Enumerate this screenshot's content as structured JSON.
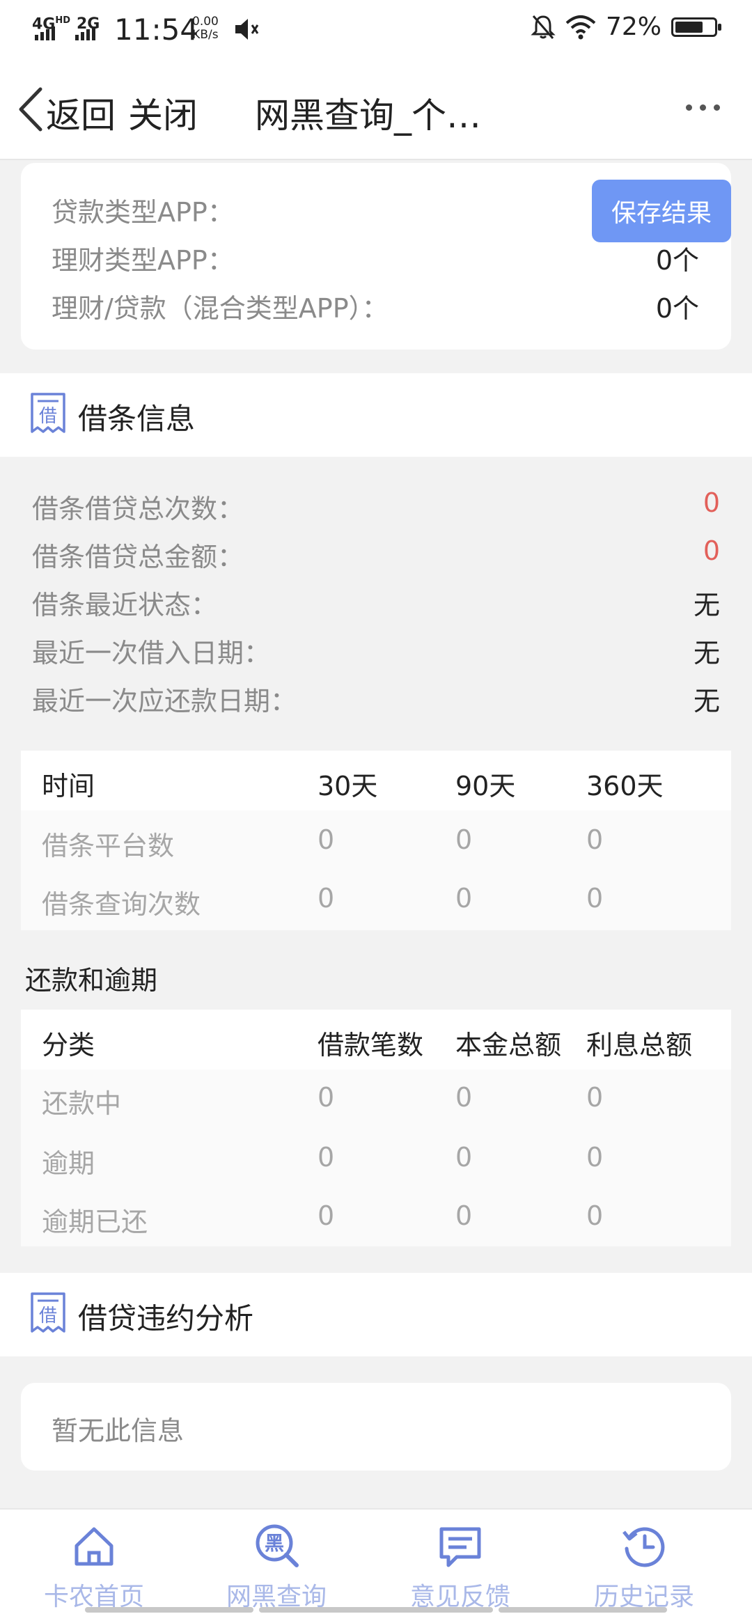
{
  "status_bar": {
    "network1": "4G",
    "network1_sup": "HD",
    "network2": "2G",
    "time": "11:54",
    "speed_value": "0.00",
    "speed_unit": "KB/s",
    "battery": "72%",
    "battery_level": 0.72
  },
  "nav": {
    "back_label": "返回",
    "close_label": "关闭",
    "title": "网黑查询_个…"
  },
  "app_card": {
    "save_button": "保存结果",
    "rows": [
      {
        "label": "贷款类型APP：",
        "value": ""
      },
      {
        "label": "理财类型APP：",
        "value": "0个"
      },
      {
        "label": "理财/贷款（混合类型APP）：",
        "value": "0个"
      }
    ]
  },
  "iou_section": {
    "icon_char": "借",
    "title": "借条信息",
    "rows": [
      {
        "label": "借条借贷总次数：",
        "value": "0"
      },
      {
        "label": "借条借贷总金额：",
        "value": "0"
      },
      {
        "label": "借条最近状态：",
        "value": "无"
      },
      {
        "label": "最近一次借入日期：",
        "value": "无"
      },
      {
        "label": "最近一次应还款日期：",
        "value": "无"
      }
    ],
    "table": {
      "headers": [
        "时间",
        "30天",
        "90天",
        "360天"
      ],
      "rows": [
        [
          "借条平台数",
          "0",
          "0",
          "0"
        ],
        [
          "借条查询次数",
          "0",
          "0",
          "0"
        ]
      ]
    },
    "repay_title": "还款和逾期",
    "repay_table": {
      "headers": [
        "分类",
        "借款笔数",
        "本金总额",
        "利息总额"
      ],
      "rows": [
        [
          "还款中",
          "0",
          "0",
          "0"
        ],
        [
          "逾期",
          "0",
          "0",
          "0"
        ],
        [
          "逾期已还",
          "0",
          "0",
          "0"
        ]
      ]
    }
  },
  "default_section": {
    "icon_char": "借",
    "title": "借贷违约分析",
    "empty_text": "暂无此信息"
  },
  "tab_bar": {
    "tabs": [
      {
        "label": "卡农首页",
        "icon": "home-icon"
      },
      {
        "label": "网黑查询",
        "icon": "blacklist-search-icon",
        "icon_char": "黑"
      },
      {
        "label": "意见反馈",
        "icon": "feedback-icon"
      },
      {
        "label": "历史记录",
        "icon": "history-icon"
      }
    ]
  },
  "colors": {
    "accent": "#6f97f4",
    "icon_blue": "#6a82d8",
    "tab_label": "#a9b8e8",
    "red_value": "#e2605a"
  }
}
